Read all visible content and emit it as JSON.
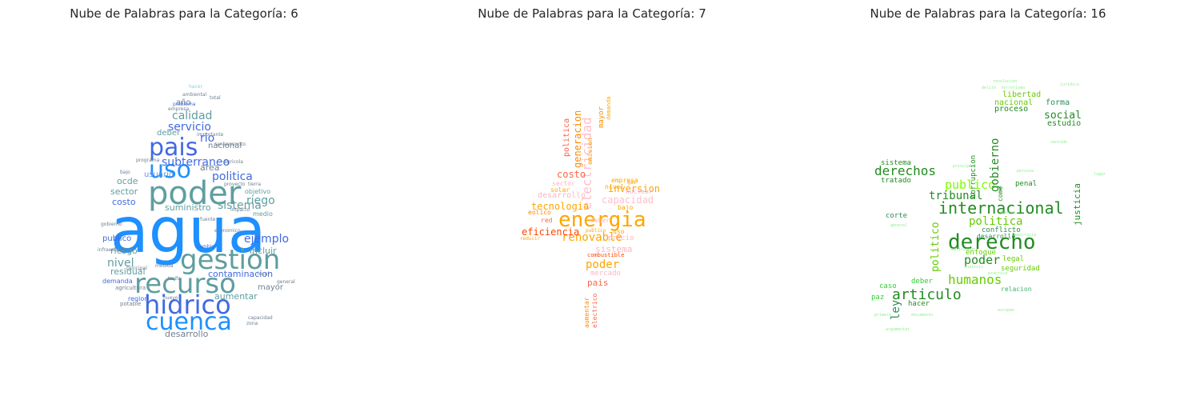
{
  "panels": [
    {
      "title": "Nube de Palabras para la Categoría: 6",
      "shape": "drop",
      "words": [
        "agua",
        "poder",
        "gestion",
        "recurso",
        "hidrico",
        "cuenca",
        "pais",
        "uso",
        "calidad",
        "servicio",
        "rio",
        "subterraneo",
        "politica",
        "sistema",
        "riego",
        "ejemplo",
        "incluir",
        "nivel",
        "riesgo",
        "residual",
        "contaminacion",
        "aumentar",
        "desarrollo",
        "costo",
        "sector",
        "ocde",
        "suministro",
        "area",
        "usuario",
        "deber",
        "nacional",
        "publico",
        "mayor",
        "año",
        "demanda",
        "objetivo",
        "medio",
        "region",
        "agricultura",
        "potable",
        "hacer",
        "ambiental",
        "problema",
        "saneamiento",
        "agricola",
        "proyecto",
        "impacto",
        "cambio",
        "medida",
        "tarifa",
        "importante",
        "local",
        "general",
        "principal",
        "nuevo",
        "capacidad",
        "zona",
        "economico",
        "tierra",
        "bajo",
        "programa",
        "gobierno",
        "infraestructura",
        "empresa",
        "total",
        "calidad",
        "fuente",
        "agua"
      ]
    },
    {
      "title": "Nube de Palabras para la Categoría: 7",
      "shape": "bolt",
      "words": [
        "energia",
        "electricidad",
        "renovable",
        "poder",
        "eficiencia",
        "tecnologia",
        "generacion",
        "politica",
        "costo",
        "inversion",
        "capacidad",
        "desarrollo",
        "sistema",
        "pais",
        "mercado",
        "combustible",
        "precio",
        "empresa",
        "nivel",
        "sector",
        "solar",
        "red",
        "eolico",
        "nuclear",
        "emision",
        "mayor",
        "demanda",
        "aumentar",
        "electrico",
        "uso",
        "bajo",
        "deber",
        "publico",
        "reducir",
        "gas"
      ]
    },
    {
      "title": "Nube de Palabras para la Categoría: 16",
      "shape": "dove",
      "words": [
        "derecho",
        "internacional",
        "articulo",
        "derechos",
        "humanos",
        "poder",
        "publico",
        "politica",
        "tribunal",
        "gobierno",
        "ley",
        "politico",
        "justicia",
        "social",
        "libertad",
        "nacional",
        "proceso",
        "forma",
        "estudio",
        "sistema",
        "tratado",
        "penal",
        "corrupcion",
        "enfoque",
        "corte",
        "conflicto",
        "desarrollo",
        "legal",
        "seguridad",
        "caso",
        "deber",
        "relacion",
        "hacer",
        "paz",
        "como",
        "general",
        "persona",
        "guerra",
        "principio",
        "lugar",
        "juridico",
        "terrorismo",
        "delito",
        "practica",
        "aplicacion",
        "argumentar",
        "documento",
        "democracia",
        "primero",
        "europeo",
        "analisis",
        "sentido",
        "revolucion"
      ]
    }
  ],
  "palettes": {
    "drop": [
      "#2196f3",
      "#5f9ea0",
      "#4169e1",
      "#1e90ff",
      "#6495ed",
      "#4682b4",
      "#87ceeb",
      "#708090"
    ],
    "bolt": [
      "#ffa500",
      "#ff8c00",
      "#ff6347",
      "#ffd700",
      "#ffc0cb",
      "#ffb6c1",
      "#ff4500",
      "#f4a460"
    ],
    "dove": [
      "#228b22",
      "#32cd32",
      "#7cfc00",
      "#2e8b57",
      "#3cb371",
      "#66cd00",
      "#90ee90",
      "#006400"
    ]
  }
}
